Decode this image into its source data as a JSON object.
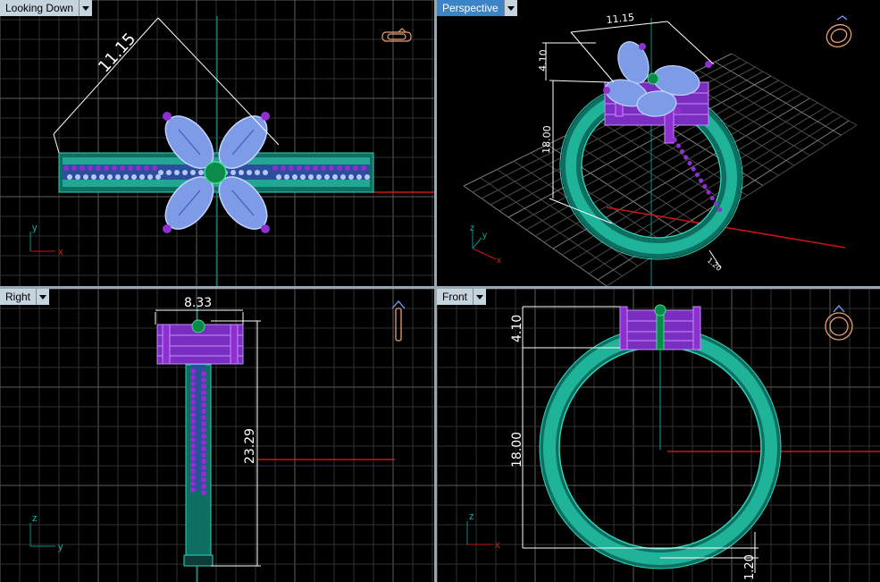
{
  "viewports": {
    "top": {
      "title": "Looking Down",
      "dim": "11.15",
      "axis_a": "y",
      "axis_b": "x"
    },
    "persp": {
      "title": "Perspective",
      "dim_w": "11.15",
      "dim_h1": "4.10",
      "dim_h2": "18.00",
      "dim_small": "1.20",
      "axis_a": "z",
      "axis_b": "y",
      "axis_c": "x"
    },
    "right": {
      "title": "Right",
      "dim_w": "8.33",
      "dim_h": "23.29",
      "axis_a": "z",
      "axis_b": "y"
    },
    "front": {
      "title": "Front",
      "dim_top": "4.10",
      "dim_mid": "18.00",
      "dim_bot": "1.20",
      "axis_a": "z",
      "axis_b": "x"
    }
  },
  "active_viewport": "Perspective",
  "colors": {
    "grid": "#303030",
    "grid_major": "#5e5e5e",
    "axis_green": "#108a8a",
    "axis_red": "#c81616",
    "band": "#1fb39a",
    "band_dark": "#0d6f61",
    "petal": "#7d9be6",
    "petal_dark": "#4a5fbf",
    "gem": "#8e2fd0",
    "center": "#0b8a4a",
    "dim_line": "#ffffff"
  },
  "icons": [
    "dropdown-arrow-icon",
    "ring-view-icon"
  ]
}
